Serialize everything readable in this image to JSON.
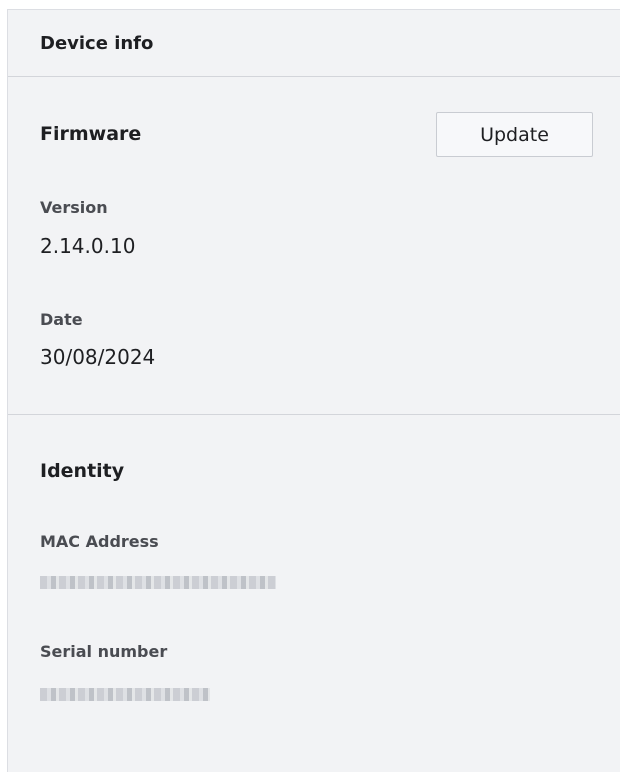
{
  "panel": {
    "title": "Device info"
  },
  "firmware": {
    "title": "Firmware",
    "update_label": "Update",
    "version_label": "Version",
    "version_value": "2.14.0.10",
    "date_label": "Date",
    "date_value": "30/08/2024"
  },
  "identity": {
    "title": "Identity",
    "mac_label": "MAC Address",
    "serial_label": "Serial number"
  }
}
